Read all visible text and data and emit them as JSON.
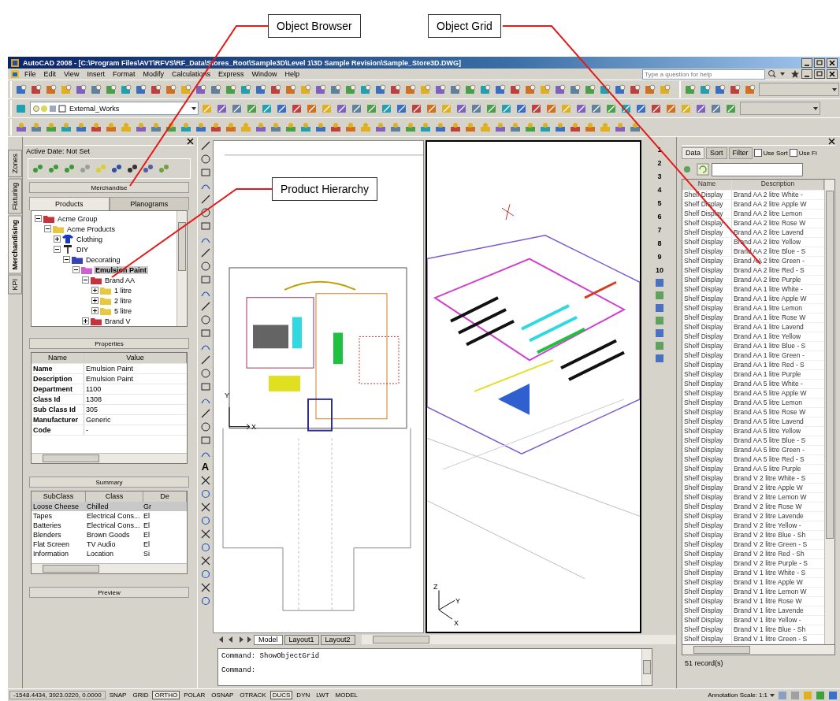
{
  "callouts": [
    {
      "label": "Object Browser"
    },
    {
      "label": "Object Grid"
    },
    {
      "label": "Product Hierarchy"
    }
  ],
  "window": {
    "title": "AutoCAD 2008 - [C:\\Program Files\\AVT\\RFVS\\RF_Data\\Stores_Root\\Sample3D\\Level 1\\3D Sample Revision\\Sample_Store3D.DWG]"
  },
  "menus": [
    "File",
    "Edit",
    "View",
    "Insert",
    "Format",
    "Modify",
    "Calculations",
    "Express",
    "Window",
    "Help"
  ],
  "help_search": {
    "placeholder": "Type a question for help"
  },
  "layer_dropdown": {
    "value": "External_Works"
  },
  "side_tabs": [
    {
      "label": "Zones",
      "selected": false
    },
    {
      "label": "Fixturing",
      "selected": false
    },
    {
      "label": "Merchandising",
      "selected": true
    },
    {
      "label": "KPI",
      "selected": false
    }
  ],
  "object_browser": {
    "active_date": "Active Date: Not Set",
    "section": "Merchandise",
    "tabs": [
      {
        "label": "Products",
        "selected": true
      },
      {
        "label": "Planograms",
        "selected": false
      }
    ]
  },
  "tree": [
    {
      "label": "Acme Group",
      "kind": "folder",
      "color": "#c8323c",
      "expanded": true,
      "selected": false,
      "children": [
        {
          "label": "Acme Products",
          "kind": "folder",
          "color": "#e8c840",
          "expanded": true,
          "selected": false,
          "children": [
            {
              "label": "Clothing",
              "kind": "shirt",
              "expanded": false,
              "selected": false
            },
            {
              "label": "DIY",
              "kind": "hammer",
              "expanded": true,
              "selected": false,
              "children": [
                {
                  "label": "Decorating",
                  "kind": "folder",
                  "color": "#3a40b8",
                  "expanded": true,
                  "selected": false,
                  "children": [
                    {
                      "label": "Emulsion Paint",
                      "kind": "folder",
                      "color": "#d060d0",
                      "expanded": true,
                      "selected": true,
                      "children": [
                        {
                          "label": "Brand AA",
                          "kind": "folder",
                          "color": "#c8323c",
                          "expanded": true,
                          "selected": false,
                          "children": [
                            {
                              "label": "1 litre",
                              "kind": "folder",
                              "color": "#e8c840",
                              "expanded": false,
                              "selected": false
                            },
                            {
                              "label": "2 litre",
                              "kind": "folder",
                              "color": "#e8c840",
                              "expanded": false,
                              "selected": false
                            },
                            {
                              "label": "5 litre",
                              "kind": "folder",
                              "color": "#e8c840",
                              "expanded": false,
                              "selected": false
                            }
                          ]
                        },
                        {
                          "label": "Brand V",
                          "kind": "folder",
                          "color": "#c8323c",
                          "expanded": false,
                          "selected": false
                        }
                      ]
                    }
                  ]
                }
              ]
            }
          ]
        }
      ]
    }
  ],
  "properties": {
    "title": "Properties",
    "columns": [
      "Name",
      "Value"
    ],
    "rows": [
      [
        "Name",
        "Emulsion Paint"
      ],
      [
        "Description",
        "Emulsion Paint"
      ],
      [
        "Department",
        "1100"
      ],
      [
        "Class Id",
        "1308"
      ],
      [
        "Sub Class Id",
        "305"
      ],
      [
        "Manufacturer",
        "Generic"
      ],
      [
        "Code",
        "-"
      ]
    ]
  },
  "summary": {
    "title": "Summary",
    "columns": [
      "SubClass",
      "Class",
      "De"
    ],
    "rows": [
      {
        "cells": [
          "Loose Cheese",
          "Chilled",
          "Gr"
        ],
        "selected": true
      },
      {
        "cells": [
          "Tapes",
          "Electrical Cons...",
          "El"
        ],
        "selected": false
      },
      {
        "cells": [
          "Batteries",
          "Electrical Cons...",
          "El"
        ],
        "selected": false
      },
      {
        "cells": [
          "Blenders",
          "Brown Goods",
          "El"
        ],
        "selected": false
      },
      {
        "cells": [
          "Flat Screen",
          "TV  Audio",
          "El"
        ],
        "selected": false
      },
      {
        "cells": [
          "Information",
          "Location",
          "Si"
        ],
        "selected": false
      }
    ]
  },
  "preview": {
    "title": "Preview"
  },
  "draw_toolbar": {
    "text_tool": "A"
  },
  "plan_view": {
    "axis_labels": [
      "Y",
      "X"
    ]
  },
  "iso_view": {
    "axis_labels": [
      "Z",
      "Y",
      "X"
    ]
  },
  "view_numbers": [
    "1",
    "2",
    "3",
    "4",
    "5",
    "6",
    "7",
    "8",
    "9",
    "10"
  ],
  "layout_tabs": [
    {
      "label": "Model",
      "selected": true
    },
    {
      "label": "Layout1",
      "selected": false
    },
    {
      "label": "Layout2",
      "selected": false
    }
  ],
  "command_lines": [
    "Command: ShowObjectGrid",
    "Command:"
  ],
  "object_grid": {
    "tabs": [
      {
        "label": "Data",
        "selected": true
      },
      {
        "label": "Sort",
        "selected": false
      },
      {
        "label": "Filter",
        "selected": false
      }
    ],
    "options": [
      {
        "label": "Use Sort",
        "checked": false
      },
      {
        "label": "Use Fi",
        "checked": false
      }
    ],
    "columns": [
      "Name",
      "Description"
    ],
    "rows": [
      [
        "Shelf Display",
        "Brand AA 2 litre White -"
      ],
      [
        "Shelf Display",
        "Brand AA 2 litre Apple W"
      ],
      [
        "Shelf Display",
        "Brand AA 2 litre Lemon"
      ],
      [
        "Shelf Display",
        "Brand AA 2 litre Rose W"
      ],
      [
        "Shelf Display",
        "Brand AA 2 litre Lavend"
      ],
      [
        "Shelf Display",
        "Brand AA 2 litre Yellow"
      ],
      [
        "Shelf Display",
        "Brand AA 2 litre Blue - S"
      ],
      [
        "Shelf Display",
        "Brand AA 2 litre Green -"
      ],
      [
        "Shelf Display",
        "Brand AA 2 litre Red - S"
      ],
      [
        "Shelf Display",
        "Brand AA 2 litre Purple"
      ],
      [
        "Shelf Display",
        "Brand AA 1 litre White -"
      ],
      [
        "Shelf Display",
        "Brand AA 1 litre Apple W"
      ],
      [
        "Shelf Display",
        "Brand AA 1 litre Lemon"
      ],
      [
        "Shelf Display",
        "Brand AA 1 litre Rose W"
      ],
      [
        "Shelf Display",
        "Brand AA 1 litre Lavend"
      ],
      [
        "Shelf Display",
        "Brand AA 1 litre Yellow"
      ],
      [
        "Shelf Display",
        "Brand AA 1 litre Blue - S"
      ],
      [
        "Shelf Display",
        "Brand AA 1 litre Green -"
      ],
      [
        "Shelf Display",
        "Brand AA 1 litre Red - S"
      ],
      [
        "Shelf Display",
        "Brand AA 1 litre Purple"
      ],
      [
        "Shelf Display",
        "Brand AA 5 litre White -"
      ],
      [
        "Shelf Display",
        "Brand AA 5 litre Apple W"
      ],
      [
        "Shelf Display",
        "Brand AA 5 litre Lemon"
      ],
      [
        "Shelf Display",
        "Brand AA 5 litre Rose W"
      ],
      [
        "Shelf Display",
        "Brand AA 5 litre Lavend"
      ],
      [
        "Shelf Display",
        "Brand AA 5 litre Yellow"
      ],
      [
        "Shelf Display",
        "Brand AA 5 litre Blue - S"
      ],
      [
        "Shelf Display",
        "Brand AA 5 litre Green -"
      ],
      [
        "Shelf Display",
        "Brand AA 5 litre Red - S"
      ],
      [
        "Shelf Display",
        "Brand AA 5 litre Purple"
      ],
      [
        "Shelf Display",
        "Brand V 2 litre White - S"
      ],
      [
        "Shelf Display",
        "Brand V 2 litre Apple W"
      ],
      [
        "Shelf Display",
        "Brand V 2 litre Lemon W"
      ],
      [
        "Shelf Display",
        "Brand V 2 litre Rose W"
      ],
      [
        "Shelf Display",
        "Brand V 2 litre Lavende"
      ],
      [
        "Shelf Display",
        "Brand V 2 litre Yellow -"
      ],
      [
        "Shelf Display",
        "Brand V 2 litre Blue - Sh"
      ],
      [
        "Shelf Display",
        "Brand V 2 litre Green - S"
      ],
      [
        "Shelf Display",
        "Brand V 2 litre Red - Sh"
      ],
      [
        "Shelf Display",
        "Brand V 2 litre Purple - S"
      ],
      [
        "Shelf Display",
        "Brand V 1 litre White - S"
      ],
      [
        "Shelf Display",
        "Brand V 1 litre Apple W"
      ],
      [
        "Shelf Display",
        "Brand V 1 litre Lemon W"
      ],
      [
        "Shelf Display",
        "Brand V 1 litre Rose W"
      ],
      [
        "Shelf Display",
        "Brand V 1 litre Lavende"
      ],
      [
        "Shelf Display",
        "Brand V 1 litre Yellow -"
      ],
      [
        "Shelf Display",
        "Brand V 1 litre Blue - Sh"
      ],
      [
        "Shelf Display",
        "Brand V 1 litre Green - S"
      ]
    ],
    "record_count": "51 record(s)"
  },
  "status_bar": {
    "coordinates": "-1548.4434, 3923.0220, 0.0000",
    "toggles": [
      {
        "label": "SNAP",
        "on": false
      },
      {
        "label": "GRID",
        "on": false
      },
      {
        "label": "ORTHO",
        "on": true
      },
      {
        "label": "POLAR",
        "on": false
      },
      {
        "label": "OSNAP",
        "on": false
      },
      {
        "label": "OTRACK",
        "on": false
      },
      {
        "label": "DUCS",
        "on": true
      },
      {
        "label": "DYN",
        "on": false
      },
      {
        "label": "LWT",
        "on": false
      },
      {
        "label": "MODEL",
        "on": false
      }
    ],
    "annotation_label": "Annotation Scale:",
    "annotation_value": "1:1"
  }
}
